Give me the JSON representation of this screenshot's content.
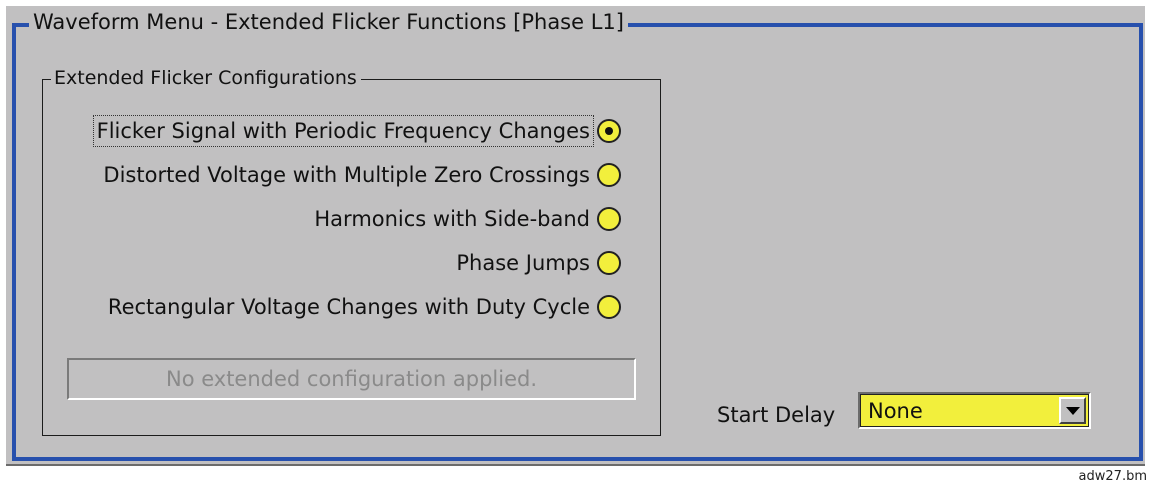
{
  "window": {
    "title": "Waveform Menu - Extended Flicker Functions [Phase L1]"
  },
  "flicker_group": {
    "title": "Extended Flicker Configurations",
    "options": [
      {
        "label": "Flicker Signal with Periodic Frequency Changes",
        "selected": true
      },
      {
        "label": "Distorted Voltage with Multiple Zero Crossings",
        "selected": false
      },
      {
        "label": "Harmonics with Side-band",
        "selected": false
      },
      {
        "label": "Phase Jumps",
        "selected": false
      },
      {
        "label": "Rectangular Voltage Changes with Duty Cycle",
        "selected": false
      }
    ],
    "status_text": "No extended configuration applied."
  },
  "start_delay": {
    "label": "Start Delay",
    "value": "None"
  },
  "caption": "adw27.bm",
  "colors": {
    "background": "#c1c0c1",
    "frame_border": "#2750ad",
    "control_fill": "#f2ef3c"
  }
}
